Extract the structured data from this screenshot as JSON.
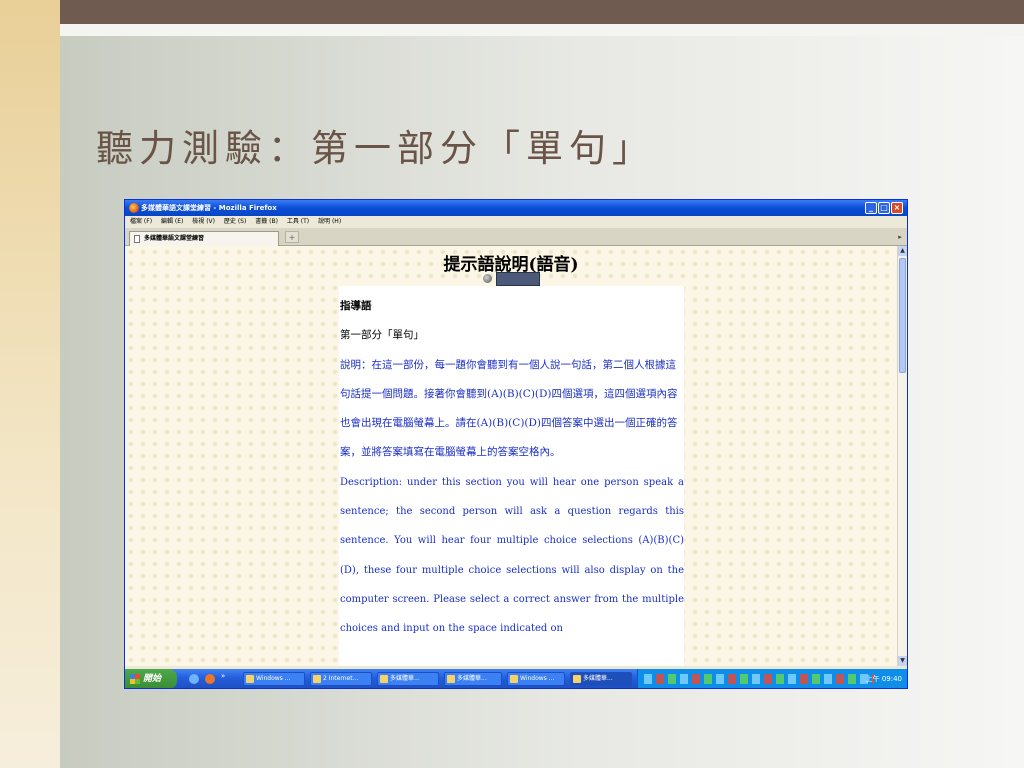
{
  "slide": {
    "title": "聽力測驗：第一部分「單句」"
  },
  "browser": {
    "window_title": "多媒體華語文課堂練習 - Mozilla Firefox",
    "menu": [
      "檔案 (F)",
      "編輯 (E)",
      "檢視 (V)",
      "歷史 (S)",
      "書籤 (B)",
      "工具 (T)",
      "說明 (H)"
    ],
    "tab_label": "多媒體華語文課堂練習",
    "new_tab_symbol": "+"
  },
  "page": {
    "heading": "提示語說明(語音)",
    "instructions_title": "指導語",
    "instructions_subtitle": "第一部分「單句」",
    "instructions_zh": "說明：在這一部份，每一題你會聽到有一個人說一句話，第二個人根據這句話提一個問題。接著你會聽到(A)(B)(C)(D)四個選項，這四個選項內容也會出現在電腦螢幕上。請在(A)(B)(C)(D)四個答案中選出一個正確的答案，並將答案填寫在電腦螢幕上的答案空格內。",
    "instructions_en": "Description: under this section you will hear one person speak a sentence; the second person will ask a question regards this sentence. You will hear four multiple choice selections (A)(B)(C)(D), these four multiple choice selections will also display on the computer screen. Please select a correct answer from the multiple choices and input on the space indicated on"
  },
  "taskbar": {
    "start_label": "開始",
    "quicklaunch_more": "»",
    "tasks": [
      {
        "label": "Windows ..."
      },
      {
        "label": "2 Internet..."
      },
      {
        "label": "多媒體華..."
      },
      {
        "label": "多媒體華..."
      },
      {
        "label": "Windows ..."
      },
      {
        "label": "多媒體華..."
      }
    ],
    "clock": "上午 09:40"
  }
}
